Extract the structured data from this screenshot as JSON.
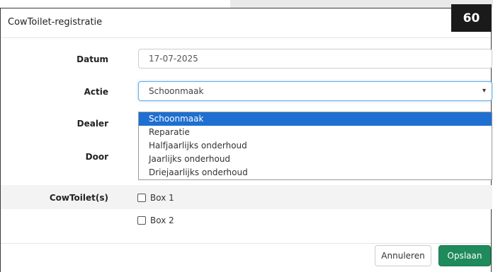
{
  "modal": {
    "title": "CowToilet-registratie",
    "badge": "60"
  },
  "form": {
    "datum_label": "Datum",
    "datum_value": "17-07-2025",
    "actie_label": "Actie",
    "actie_value": "Schoonmaak",
    "dealer_label": "Dealer",
    "door_label": "Door",
    "cowtoilets_label": "CowToilet(s)",
    "checkbox_1": "Box 1",
    "checkbox_2": "Box 2"
  },
  "dropdown": {
    "options": [
      "Schoonmaak",
      "Reparatie",
      "Halfjaarlijks onderhoud",
      "Jaarlijks onderhoud",
      "Driejaarlijks onderhoud"
    ],
    "selected_index": 0
  },
  "footer": {
    "cancel_label": "Annuleren",
    "save_label": "Opslaan"
  },
  "colors": {
    "save_button": "#1f8a5b",
    "selected_option": "#1e6fd1",
    "badge_bg": "#1a1a1a"
  }
}
